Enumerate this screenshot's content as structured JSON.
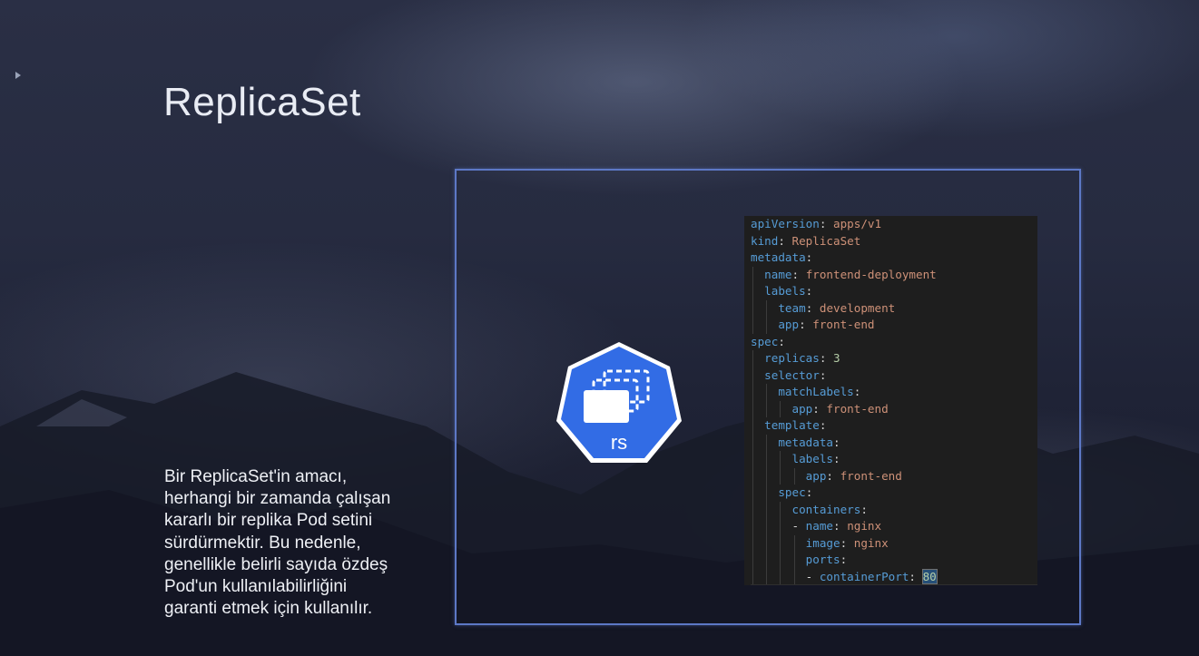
{
  "slide": {
    "title": "ReplicaSet",
    "description_lines": [
      "Bir ReplicaSet'in amacı,",
      "herhangi bir zamanda çalışan",
      "kararlı bir replika Pod setini",
      "sürdürmektir. Bu nedenle,",
      "genellikle belirli sayıda özdeş",
      "Pod'un kullanılabilirliğini",
      "garanti etmek için kullanılır."
    ],
    "logo": {
      "icon": "kubernetes-replicaset-icon",
      "label": "rs",
      "color": "#326ce5"
    },
    "frame_color": "#5d78c6"
  },
  "code": {
    "lines": [
      {
        "indent": 0,
        "key": "apiVersion",
        "value": "apps/v1"
      },
      {
        "indent": 0,
        "key": "kind",
        "value": "ReplicaSet"
      },
      {
        "indent": 0,
        "key": "metadata",
        "value": ""
      },
      {
        "indent": 1,
        "key": "name",
        "value": "frontend-deployment"
      },
      {
        "indent": 1,
        "key": "labels",
        "value": ""
      },
      {
        "indent": 2,
        "key": "team",
        "value": "development"
      },
      {
        "indent": 2,
        "key": "app",
        "value": "front-end"
      },
      {
        "indent": 0,
        "key": "spec",
        "value": ""
      },
      {
        "indent": 1,
        "key": "replicas",
        "value": "3",
        "numeric": true
      },
      {
        "indent": 1,
        "key": "selector",
        "value": ""
      },
      {
        "indent": 2,
        "key": "matchLabels",
        "value": ""
      },
      {
        "indent": 3,
        "key": "app",
        "value": "front-end"
      },
      {
        "indent": 1,
        "key": "template",
        "value": ""
      },
      {
        "indent": 2,
        "key": "metadata",
        "value": ""
      },
      {
        "indent": 3,
        "key": "labels",
        "value": ""
      },
      {
        "indent": 4,
        "key": "app",
        "value": "front-end"
      },
      {
        "indent": 2,
        "key": "spec",
        "value": ""
      },
      {
        "indent": 3,
        "key": "containers",
        "value": ""
      },
      {
        "indent": 3,
        "dash": true,
        "key": "name",
        "value": "nginx"
      },
      {
        "indent": 4,
        "key": "image",
        "value": "nginx"
      },
      {
        "indent": 4,
        "key": "ports",
        "value": ""
      },
      {
        "indent": 4,
        "dash": true,
        "key": "containerPort",
        "value": "80",
        "numeric": true,
        "cursor": true
      }
    ],
    "colors": {
      "background": "#1e1e1e",
      "key": "#569cd6",
      "string": "#ce9178",
      "number": "#b5cea8",
      "punctuation": "#d4d4d4"
    }
  }
}
